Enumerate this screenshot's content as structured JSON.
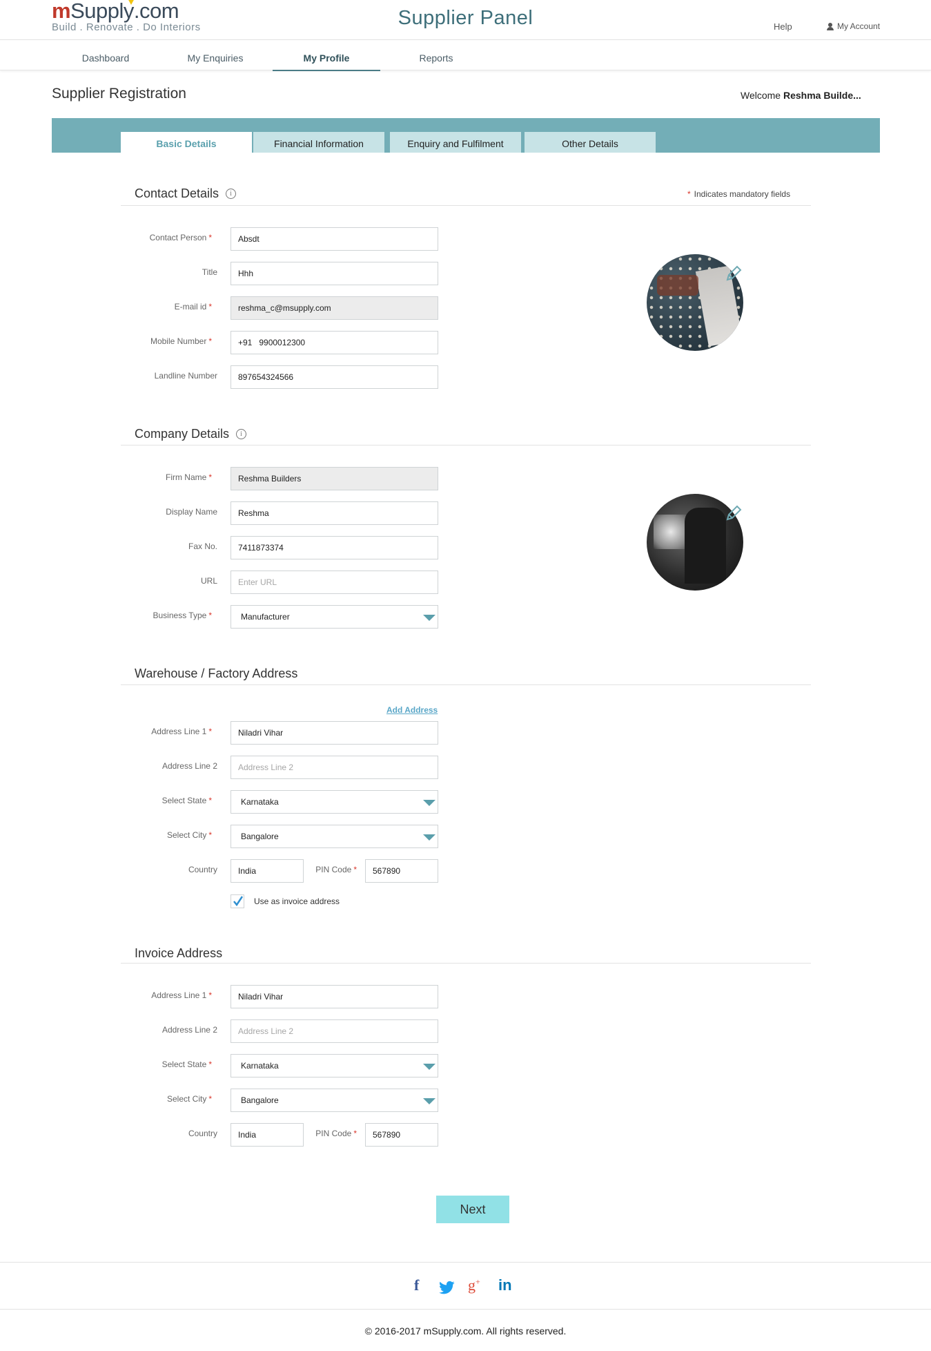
{
  "header": {
    "logo_m": "m",
    "logo_supply": "Suppl",
    "logo_y": "y",
    "logo_com": ".com",
    "logo_tagline": "Build . Renovate . Do Interiors",
    "panel_title": "Supplier Panel",
    "help": "Help",
    "my_account": "My Account"
  },
  "nav": {
    "items": [
      {
        "label": "Dashboard"
      },
      {
        "label": "My Enquiries"
      },
      {
        "label": "My Profile",
        "active": true
      },
      {
        "label": "Reports"
      }
    ]
  },
  "page": {
    "title": "Supplier Registration",
    "welcome_prefix": "Welcome ",
    "welcome_name": "Reshma Builde..."
  },
  "tabs": [
    {
      "label": "Basic Details",
      "active": true
    },
    {
      "label": "Financial Information"
    },
    {
      "label": "Enquiry and Fulfilment"
    },
    {
      "label": "Other Details"
    }
  ],
  "mandatory_note": "Indicates mandatory fields",
  "contact": {
    "title": "Contact Details",
    "fields": [
      {
        "label": "Contact Person",
        "value": "Absdt",
        "required": true
      },
      {
        "label": "Title",
        "value": "Hhh"
      },
      {
        "label": "E-mail id",
        "value": "reshma_c@msupply.com",
        "required": true
      },
      {
        "label": "Mobile Number",
        "value": "+91   9900012300",
        "required": true
      },
      {
        "label": "Landline Number",
        "value": "897654324566"
      }
    ]
  },
  "company": {
    "title": "Company Details",
    "fields": [
      {
        "label": "Firm Name",
        "value": "Reshma Builders",
        "required": true
      },
      {
        "label": "Display Name",
        "value": "Reshma"
      },
      {
        "label": "Fax No.",
        "value": "7411873374"
      },
      {
        "label": "URL",
        "placeholder": "Enter URL"
      },
      {
        "label": "Business Type",
        "value": "Manufacturer",
        "required": true
      }
    ]
  },
  "warehouse": {
    "title": "Warehouse / Factory Address",
    "add_address": "Add Address",
    "address1_label": "Address Line 1",
    "address1_value": "Niladri Vihar",
    "address2_label": "Address Line 2",
    "address2_placeholder": "Address Line 2",
    "state_label": "Select State",
    "state_value": "Karnataka",
    "city_label": "Select City",
    "city_value": "Bangalore",
    "country_label": "Country",
    "country_value": "India",
    "pin_label": "PIN Code",
    "pin_value": "567890",
    "invoice_checkbox_label": "Use as invoice address",
    "invoice_checked": true
  },
  "invoice": {
    "title": "Invoice Address",
    "address1_label": "Address Line 1",
    "address1_value": "Niladri Vihar",
    "address2_label": "Address Line 2",
    "address2_placeholder": "Address Line 2",
    "state_label": "Select State",
    "state_value": "Karnataka",
    "city_label": "Select City",
    "city_value": "Bangalore",
    "country_label": "Country",
    "country_value": "India",
    "pin_label": "PIN Code",
    "pin_value": "567890"
  },
  "next_button": "Next",
  "social": [
    {
      "icon": "facebook-icon",
      "glyph": "f",
      "color": "#3b5998"
    },
    {
      "icon": "twitter-icon",
      "color": "#1da1f2"
    },
    {
      "icon": "google-plus-icon",
      "glyph": "g",
      "color": "#dd4b39"
    },
    {
      "icon": "linkedin-icon",
      "glyph": "in",
      "color": "#0077b5"
    }
  ],
  "copyright": "© 2016-2017 mSupply.com. All rights reserved.",
  "colors": {
    "accent": "#73aeb7",
    "tab_inactive": "#c7e3e6",
    "next_button": "#91e1e6",
    "required_star": "#d9362b",
    "brand_red": "#c0392b"
  }
}
